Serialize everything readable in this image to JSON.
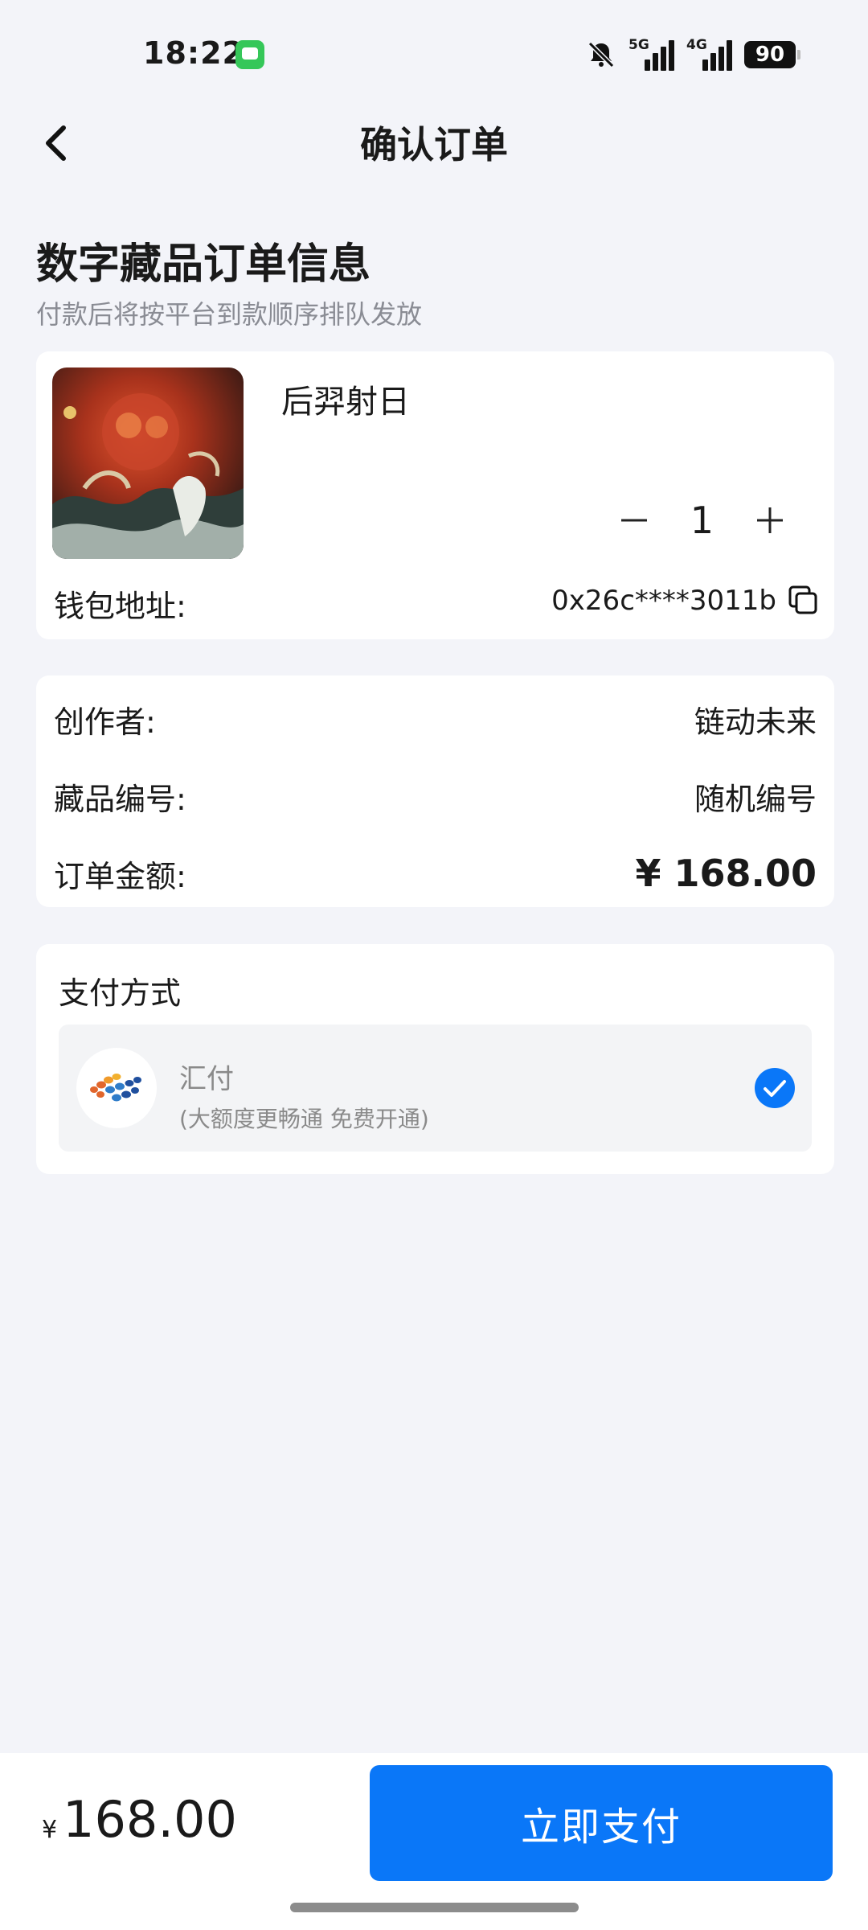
{
  "status_bar": {
    "time": "18:22",
    "signal_1_label": "5G",
    "signal_2_label": "4G",
    "battery": "90"
  },
  "nav": {
    "title": "确认订单"
  },
  "section": {
    "title": "数字藏品订单信息",
    "subtitle": "付款后将按平台到款顺序排队发放"
  },
  "product": {
    "name": "后羿射日",
    "quantity": "1",
    "wallet_label": "钱包地址:",
    "wallet_value": "0x26c****3011b"
  },
  "info": {
    "creator_label": "创作者:",
    "creator_value": "链动未来",
    "serial_label": "藏品编号:",
    "serial_value": "随机编号",
    "amount_label": "订单金额:",
    "amount_value": "¥ 168.00"
  },
  "payment": {
    "title": "支付方式",
    "method_name": "汇付",
    "method_desc": "(大额度更畅通 免费开通)",
    "selected": true
  },
  "bottom": {
    "currency": "¥",
    "total": "168.00",
    "pay_button": "立即支付"
  },
  "colors": {
    "accent": "#0a77f8",
    "background": "#f3f4f9"
  }
}
